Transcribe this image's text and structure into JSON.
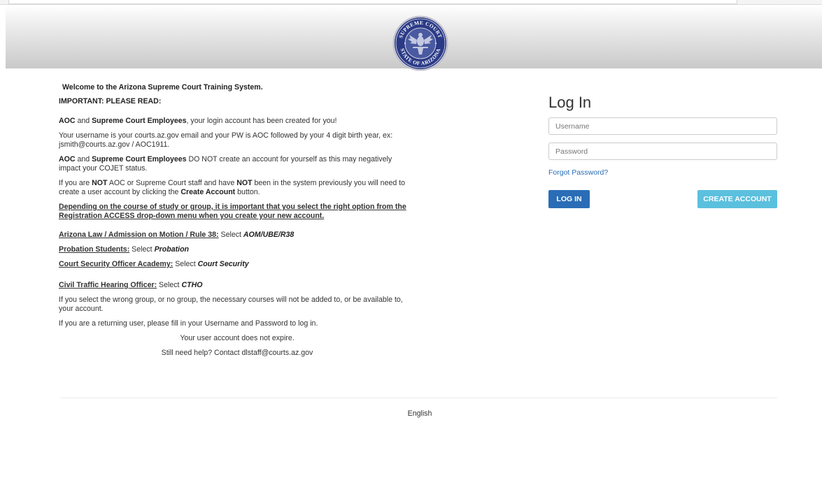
{
  "seal": {
    "top_text": "SUPREME COURT",
    "bottom_text": "STATE OF ARIZONA"
  },
  "intro": {
    "welcome": "Welcome to the Arizona Supreme Court Training System.",
    "important": "IMPORTANT: PLEASE READ:"
  },
  "employees1": {
    "aoc": "AOC",
    "and": " and ",
    "sce": "Supreme Court Employees",
    "rest": ", your login account has been created for you!"
  },
  "username_info": "Your username is your courts.az.gov email and your PW is AOC followed by your 4 digit birth year, ex: jsmith@courts.az.gov / AOC1911.",
  "employees2": {
    "aoc": "AOC",
    "and": " and ",
    "sce": "Supreme Court Employees",
    "rest": " DO NOT create an account for yourself as this may negatively impact your COJET status."
  },
  "not_staff": {
    "p1": "If you are ",
    "not1": "NOT",
    "p2": " AOC or Supreme Court staff and have ",
    "not2": "NOT",
    "p3": " been in the system previously you will need to create a user account by clicking the ",
    "create": "Create Account",
    "p4": " button."
  },
  "depending": "Depending on the course of study or group, it is important that you select the right option from the Registration ACCESS drop-down menu when you create your new account.",
  "groups": [
    {
      "label": "Arizona Law / Admission on Motion / Rule 38:",
      "select": " Select ",
      "option": "AOM/UBE/R38"
    },
    {
      "label": "Probation Students:",
      "select": " Select ",
      "option": "Probation"
    },
    {
      "label": "Court Security Officer Academy:",
      "select": " Select ",
      "option": "Court Security"
    },
    {
      "label": "Civil Traffic Hearing Officer:",
      "select": " Select ",
      "option": "CTHO"
    }
  ],
  "wrong_group": "If you select the wrong group, or no group, the necessary courses will not be added to, or be available to, your account.",
  "returning": "If you are a returning user, please fill in your Username and Password to log in.",
  "no_expire": "Your user account does not expire.",
  "help": "Still need help? Contact dlstaff@courts.az.gov",
  "login": {
    "title": "Log In",
    "username_placeholder": "Username",
    "password_placeholder": "Password",
    "forgot": "Forgot Password?",
    "login_button": "LOG IN",
    "create_button": "CREATE ACCOUNT"
  },
  "footer": {
    "language": "English"
  },
  "colors": {
    "primary": "#2a6db6",
    "info": "#5bc0de",
    "seal": "#2b3a86"
  }
}
